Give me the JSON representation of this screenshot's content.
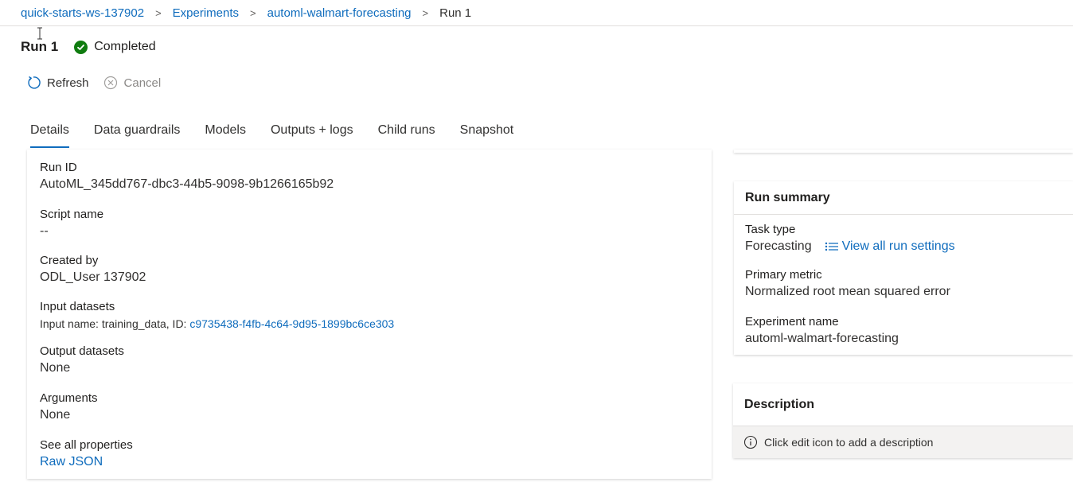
{
  "breadcrumb": {
    "items": [
      "quick-starts-ws-137902",
      "Experiments",
      "automl-walmart-forecasting"
    ],
    "current": "Run 1",
    "separator": ">"
  },
  "header": {
    "title": "Run 1",
    "status": "Completed",
    "status_color": "#107c10"
  },
  "toolbar": {
    "refresh_label": "Refresh",
    "cancel_label": "Cancel"
  },
  "tabs": [
    {
      "label": "Details",
      "active": true
    },
    {
      "label": "Data guardrails"
    },
    {
      "label": "Models"
    },
    {
      "label": "Outputs + logs"
    },
    {
      "label": "Child runs"
    },
    {
      "label": "Snapshot"
    }
  ],
  "details": {
    "run_id_label": "Run ID",
    "run_id": "AutoML_345dd767-dbc3-44b5-9098-9b1266165b92",
    "script_name_label": "Script name",
    "script_name": "--",
    "created_by_label": "Created by",
    "created_by": "ODL_User 137902",
    "input_datasets_label": "Input datasets",
    "input_datasets_prefix": "Input name: training_data, ID: ",
    "input_dataset_id": "c9735438-f4fb-4c64-9d95-1899bc6ce303",
    "output_datasets_label": "Output datasets",
    "output_datasets": "None",
    "arguments_label": "Arguments",
    "arguments": "None",
    "properties_label": "See all properties",
    "raw_json_label": "Raw JSON"
  },
  "summary": {
    "title": "Run summary",
    "task_type_label": "Task type",
    "task_type": "Forecasting",
    "view_settings_label": "View all run settings",
    "primary_metric_label": "Primary metric",
    "primary_metric": "Normalized root mean squared error",
    "experiment_name_label": "Experiment name",
    "experiment_name": "automl-walmart-forecasting"
  },
  "description": {
    "title": "Description",
    "hint": "Click edit icon to add a description"
  },
  "colors": {
    "accent": "#0f6cbd",
    "success": "#107c10"
  }
}
